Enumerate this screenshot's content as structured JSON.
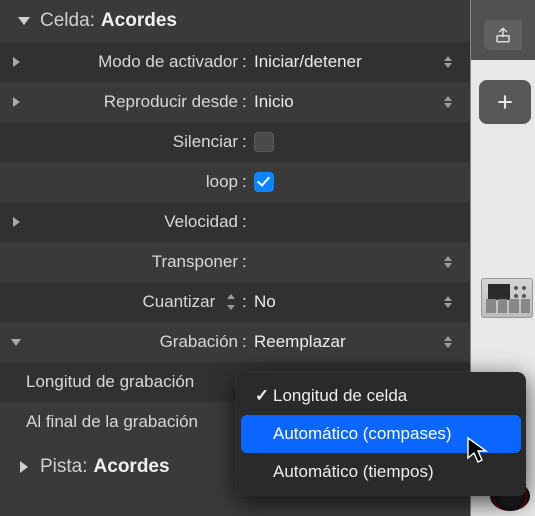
{
  "header": {
    "label": "Celda:",
    "value": "Acordes"
  },
  "rows": {
    "trigger_mode": {
      "label": "Modo de activador",
      "value": "Iniciar/detener"
    },
    "play_from": {
      "label": "Reproducir desde",
      "value": "Inicio"
    },
    "mute": {
      "label": "Silenciar"
    },
    "loop": {
      "label": "loop"
    },
    "velocity": {
      "label": "Velocidad"
    },
    "transpose": {
      "label": "Transponer"
    },
    "quantize": {
      "label": "Cuantizar",
      "value": "No"
    },
    "record": {
      "label": "Grabación",
      "value": "Reemplazar"
    },
    "rec_length": {
      "label": "Longitud de grabación"
    },
    "rec_end": {
      "label": "Al final de la grabación"
    }
  },
  "popup": {
    "items": [
      {
        "label": "Longitud de celda",
        "checked": true,
        "selected": false
      },
      {
        "label": "Automático (compases)",
        "checked": false,
        "selected": true
      },
      {
        "label": "Automático (tiempos)",
        "checked": false,
        "selected": false
      }
    ]
  },
  "track": {
    "label": "Pista:",
    "value": "Acordes"
  }
}
